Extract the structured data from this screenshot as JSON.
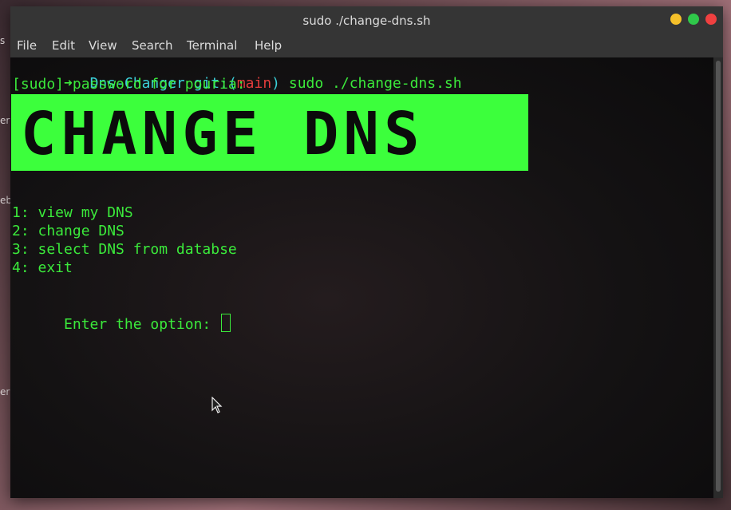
{
  "desktop": {
    "labels": [
      "s",
      "er",
      "eb",
      "er"
    ]
  },
  "window": {
    "title": "sudo ./change-dns.sh",
    "controls": {
      "minimize_color": "#f5c02a",
      "maximize_color": "#2fc84a",
      "close_color": "#f04040"
    }
  },
  "menu": [
    "File",
    "Edit",
    "View",
    "Search",
    "Terminal",
    "Help"
  ],
  "terminal": {
    "prompt_arrow": "➜",
    "prompt_dir": "Dns-Changer",
    "git_prefix": "git:(",
    "git_branch": "main",
    "git_suffix": ")",
    "command": "sudo ./change-dns.sh",
    "sudo_line": "[sudo] password for pouria:",
    "banner_text": "CHANGE DNS",
    "options": [
      "1: view my DNS",
      "2: change DNS",
      "3: select DNS from databse",
      "4: exit"
    ],
    "input_prompt": "Enter the option: "
  },
  "colors": {
    "terminal_green": "#3bea3b",
    "banner_green": "#3cff3c",
    "prompt_cyan": "#3bd0d8",
    "branch_red": "#e23c3c"
  }
}
